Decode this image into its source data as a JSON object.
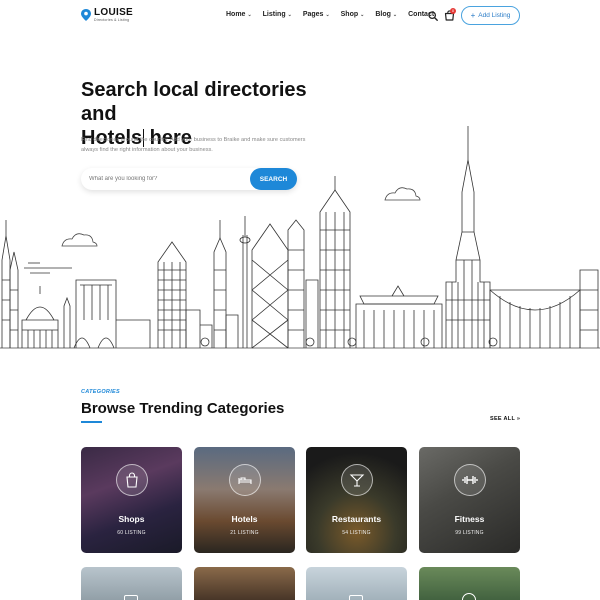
{
  "brand": {
    "name": "LOUISE",
    "tagline": "Directories & Listing"
  },
  "nav": {
    "items": [
      {
        "label": "Home",
        "dropdown": true
      },
      {
        "label": "Listing",
        "dropdown": true
      },
      {
        "label": "Pages",
        "dropdown": true
      },
      {
        "label": "Shop",
        "dropdown": true
      },
      {
        "label": "Blog",
        "dropdown": true
      },
      {
        "label": "Contact",
        "dropdown": false
      }
    ],
    "cart_count": "0",
    "add_listing_label": "Add Listing"
  },
  "hero": {
    "title_line1": "Search local directories and",
    "title_line2": "Hotels",
    "title_line2_end": " here",
    "description": "Find directories around the country. Add your business to Braike and make sure customers always find the right information about your business.",
    "search_placeholder": "What are you looking for?",
    "search_button": "SEARCH"
  },
  "categories": {
    "kicker": "CATEGORIES",
    "title": "Browse Trending Categories",
    "see_all": "SEE ALL",
    "items": [
      {
        "name": "Shops",
        "count": "60 LISTING",
        "icon": "shopping-bag-icon"
      },
      {
        "name": "Hotels",
        "count": "21 LISTING",
        "icon": "bed-icon"
      },
      {
        "name": "Restaurants",
        "count": "54 LISTING",
        "icon": "cocktail-icon"
      },
      {
        "name": "Fitness",
        "count": "99 LISTING",
        "icon": "dumbbell-icon"
      }
    ]
  },
  "colors": {
    "accent": "#1e88d8",
    "badge": "#e53935",
    "text": "#111111"
  }
}
